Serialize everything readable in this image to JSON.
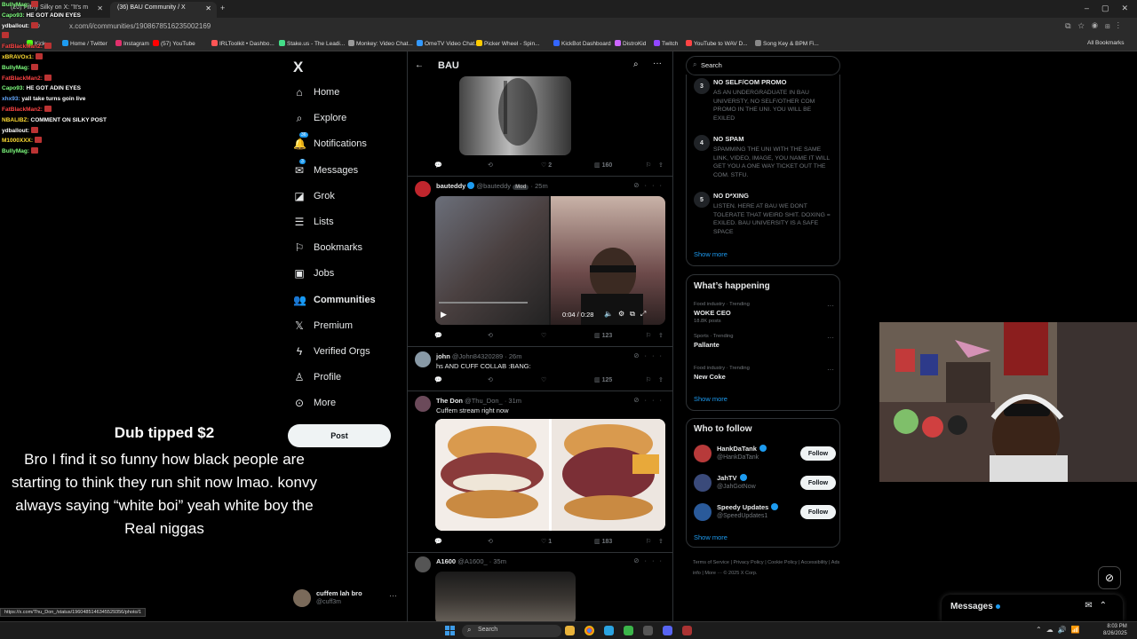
{
  "browser": {
    "tabs": [
      {
        "label": "(20) Filthy Silky on X: \"It's m",
        "active": false
      },
      {
        "label": "(36) BAU Community / X",
        "active": true
      }
    ],
    "url": "x.com/i/communities/1908678516235002169",
    "bookmarks": [
      "Kick",
      "Home / Twitter",
      "Instagram",
      "(57) YouTube",
      "IRLToolkit • Dashbo...",
      "Stake.us - The Leadi...",
      "Monkey: Video Chat...",
      "OmeTV Video Chat...",
      "Picker Wheel - Spin...",
      "KickBot Dashboard",
      "DistroKid",
      "Twitch",
      "YouTube to WAV D...",
      "Song Key & BPM Fi..."
    ],
    "all_bookmarks": "All Bookmarks",
    "status_url": "https://x.com/Thu_Don_/status/1960485146345529356/photo/1"
  },
  "chat": [
    {
      "user": "BullyMag:",
      "color": "#7fff7f",
      "msg": ""
    },
    {
      "user": "Capo93:",
      "color": "#7fff7f",
      "msg": "HE GOT ADIN EYES"
    },
    {
      "user": "ydballout:",
      "color": "#ffffff",
      "msg": ""
    },
    {
      "user": "",
      "color": "#ff4444",
      "msg": ""
    },
    {
      "user": "FatBlackMan2:",
      "color": "#ff4444",
      "msg": ""
    },
    {
      "user": "xBRAVOx1:",
      "color": "#ffdd33",
      "msg": ""
    },
    {
      "user": "BullyMag:",
      "color": "#7fff7f",
      "msg": ""
    },
    {
      "user": "FatBlackMan2:",
      "color": "#ff4444",
      "msg": ""
    },
    {
      "user": "Capo93:",
      "color": "#7fff7f",
      "msg": "HE GOT ADIN EYES"
    },
    {
      "user": "xhx93:",
      "color": "#66aaff",
      "msg": "yall take turns goin live"
    },
    {
      "user": "FatBlackMan2:",
      "color": "#ff4444",
      "msg": ""
    },
    {
      "user": "NBALIBZ:",
      "color": "#ffdd33",
      "msg": "COMMENT ON SILKY POST"
    },
    {
      "user": "ydballout:",
      "color": "#ffffff",
      "msg": ""
    },
    {
      "user": "M1000XXX:",
      "color": "#ffdd33",
      "msg": ""
    },
    {
      "user": "BullyMag:",
      "color": "#7fff7f",
      "msg": ""
    }
  ],
  "tip": {
    "title": "Dub tipped $2",
    "message": "Bro I find it so funny how black people are starting to think they run shit now lmao. konvy always saying “white boi” yeah white boy the Real niggas"
  },
  "nav": {
    "logo": "X",
    "items": [
      {
        "label": "Home",
        "icon": "home-icon",
        "glyph": "⌂",
        "bold": false
      },
      {
        "label": "Explore",
        "icon": "explore-icon",
        "glyph": "⌕",
        "bold": false
      },
      {
        "label": "Notifications",
        "icon": "bell-icon",
        "glyph": "🔔",
        "bold": false,
        "badge": "36"
      },
      {
        "label": "Messages",
        "icon": "mail-icon",
        "glyph": "✉",
        "bold": false,
        "badge": "3"
      },
      {
        "label": "Grok",
        "icon": "grok-icon",
        "glyph": "◪",
        "bold": false
      },
      {
        "label": "Lists",
        "icon": "lists-icon",
        "glyph": "☰",
        "bold": false
      },
      {
        "label": "Bookmarks",
        "icon": "bookmark-icon",
        "glyph": "⚐",
        "bold": false
      },
      {
        "label": "Jobs",
        "icon": "briefcase-icon",
        "glyph": "▣",
        "bold": false
      },
      {
        "label": "Communities",
        "icon": "communities-icon",
        "glyph": "👥",
        "bold": true
      },
      {
        "label": "Premium",
        "icon": "x-premium-icon",
        "glyph": "𝕏",
        "bold": false
      },
      {
        "label": "Verified Orgs",
        "icon": "lightning-icon",
        "glyph": "ϟ",
        "bold": false
      },
      {
        "label": "Profile",
        "icon": "person-icon",
        "glyph": "♙",
        "bold": false
      },
      {
        "label": "More",
        "icon": "more-circle-icon",
        "glyph": "⊙",
        "bold": false
      }
    ],
    "post_label": "Post",
    "account": {
      "name": "cuffem lah bro",
      "handle": "@cuff3m"
    }
  },
  "main": {
    "title": "BAU",
    "tweets": [
      {
        "actions": {
          "reply": "",
          "repost": "",
          "like": "2",
          "views": "160"
        }
      },
      {
        "name": "bauteddy",
        "handle": "@bauteddy",
        "badge": "Mod",
        "time": "25m",
        "text": "",
        "video_time": "0:04 / 0:28",
        "actions": {
          "reply": "",
          "repost": "",
          "like": "",
          "views": "123"
        }
      },
      {
        "name": "john",
        "handle": "@John84320289",
        "time": "26m",
        "text": "hs AND CUFF COLLAB :BANG:",
        "actions": {
          "reply": "",
          "repost": "",
          "like": "",
          "views": "125"
        }
      },
      {
        "name": "The Don",
        "handle": "@Thu_Don_",
        "time": "31m",
        "text": "Cuffem stream right now",
        "actions": {
          "reply": "",
          "repost": "",
          "like": "1",
          "views": "183"
        }
      },
      {
        "name": "A1600",
        "handle": "@A1600_",
        "time": "35m",
        "text": ""
      }
    ]
  },
  "right": {
    "search_placeholder": "Search",
    "rules": [
      {
        "num": "3",
        "title": "NO SELF/COM PROMO",
        "desc": "AS AN UNDERGRADUATE IN BAU UNIVERSTY, NO SELF/OTHER COM PROMO IN THE UNI. YOU WILL BE EXILED"
      },
      {
        "num": "4",
        "title": "NO SPAM",
        "desc": "SPAMMING THE UNI WITH THE SAME LINK, VIDEO, IMAGE, YOU NAME IT WILL GET YOU A ONE WAY TICKET OUT THE COM. STFU."
      },
      {
        "num": "5",
        "title": "NO D*XING",
        "desc": "LISTEN. HERE AT BAU WE DONT TOLERATE THAT WEIRD SHIT. DOXING = EXILED. BAU UNIVERSITY IS A SAFE SPACE"
      }
    ],
    "show_more": "Show more",
    "happening_title": "What’s happening",
    "trends": [
      {
        "context": "Food industry · Trending",
        "name": "WOKE CEO",
        "posts": "18.8K posts"
      },
      {
        "context": "Sports · Trending",
        "name": "Pallante",
        "posts": ""
      },
      {
        "context": "Food industry · Trending",
        "name": "New Coke",
        "posts": ""
      }
    ],
    "follow_title": "Who to follow",
    "follow": [
      {
        "name": "HankDaTank",
        "handle": "@HankDaTank",
        "button": "Follow"
      },
      {
        "name": "JahTV",
        "handle": "@JahGotNow",
        "button": "Follow"
      },
      {
        "name": "Speedy Updates",
        "handle": "@SpeedUpdates1",
        "button": "Follow"
      }
    ],
    "footer": "Terms of Service  |  Privacy Policy  |  Cookie Policy  |  Accessibility  |  Ads info  |  More ···  © 2025 X Corp."
  },
  "messages_drawer": {
    "title": "Messages"
  },
  "taskbar": {
    "search": "Search",
    "time": "8:03 PM",
    "date": "8/26/2025"
  },
  "colors": {
    "accent": "#1d9bf0",
    "bg": "#000000",
    "border": "#2f3336",
    "muted": "#71767b"
  }
}
